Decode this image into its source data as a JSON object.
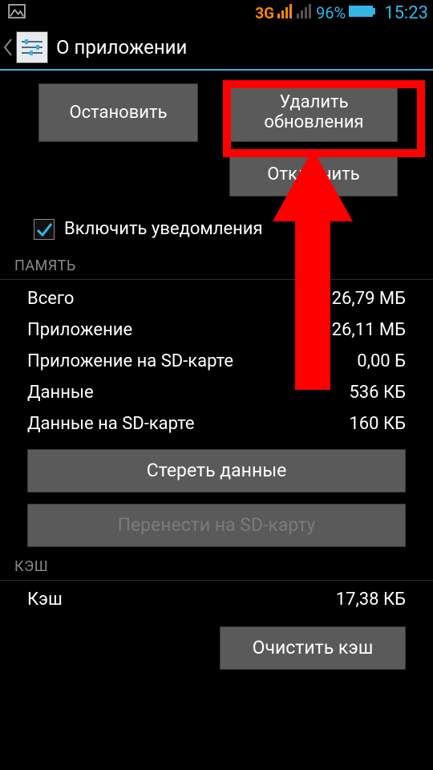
{
  "status": {
    "network_label": "3G",
    "battery_pct": "96%",
    "time": "15:23"
  },
  "header": {
    "title": "О приложении"
  },
  "actions": {
    "stop": "Остановить",
    "uninstall_updates": "Удалить обновления",
    "disable": "Отключить"
  },
  "notifications": {
    "label": "Включить уведомления",
    "checked": true
  },
  "storage": {
    "section": "ПАМЯТЬ",
    "rows": [
      {
        "label": "Всего",
        "value": "26,79 МБ"
      },
      {
        "label": "Приложение",
        "value": "26,11 МБ"
      },
      {
        "label": "Приложение на SD-карте",
        "value": "0,00 Б"
      },
      {
        "label": "Данные",
        "value": "536 КБ"
      },
      {
        "label": "Данные на SD-карте",
        "value": "160 КБ"
      }
    ],
    "clear_data": "Стереть данные",
    "move_sd": "Перенести на SD-карту"
  },
  "cache": {
    "section": "КЭШ",
    "rows": [
      {
        "label": "Кэш",
        "value": "17,38 КБ"
      }
    ],
    "clear_cache": "Очистить кэш"
  }
}
